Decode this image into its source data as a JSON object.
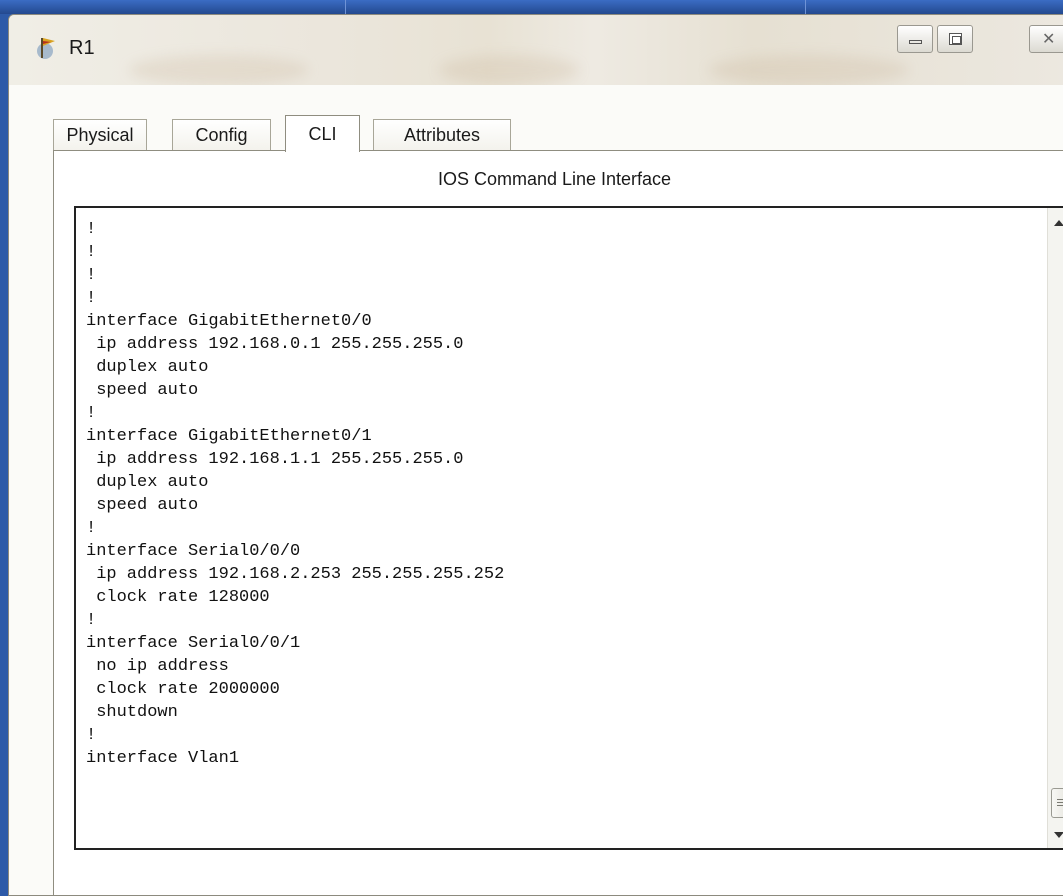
{
  "window": {
    "title": "R1",
    "icons": {
      "app": "router-flag-icon",
      "minimize": "minimize-icon",
      "maximize": "maximize-icon",
      "close": "close-icon"
    }
  },
  "tabs": [
    {
      "label": "Physical",
      "active": false
    },
    {
      "label": "Config",
      "active": false
    },
    {
      "label": "CLI",
      "active": true
    },
    {
      "label": "Attributes",
      "active": false
    }
  ],
  "cli": {
    "heading": "IOS Command Line Interface",
    "lines": [
      "!",
      "!",
      "!",
      "!",
      "interface GigabitEthernet0/0",
      " ip address 192.168.0.1 255.255.255.0",
      " duplex auto",
      " speed auto",
      "!",
      "interface GigabitEthernet0/1",
      " ip address 192.168.1.1 255.255.255.0",
      " duplex auto",
      " speed auto",
      "!",
      "interface Serial0/0/0",
      " ip address 192.168.2.253 255.255.255.252",
      " clock rate 128000",
      "!",
      "interface Serial0/0/1",
      " no ip address",
      " clock rate 2000000",
      " shutdown",
      "!",
      "interface Vlan1"
    ]
  },
  "colors": {
    "desktop": "#2d5aa8",
    "window_bg": "#ece9d8",
    "console_border": "#222222"
  }
}
